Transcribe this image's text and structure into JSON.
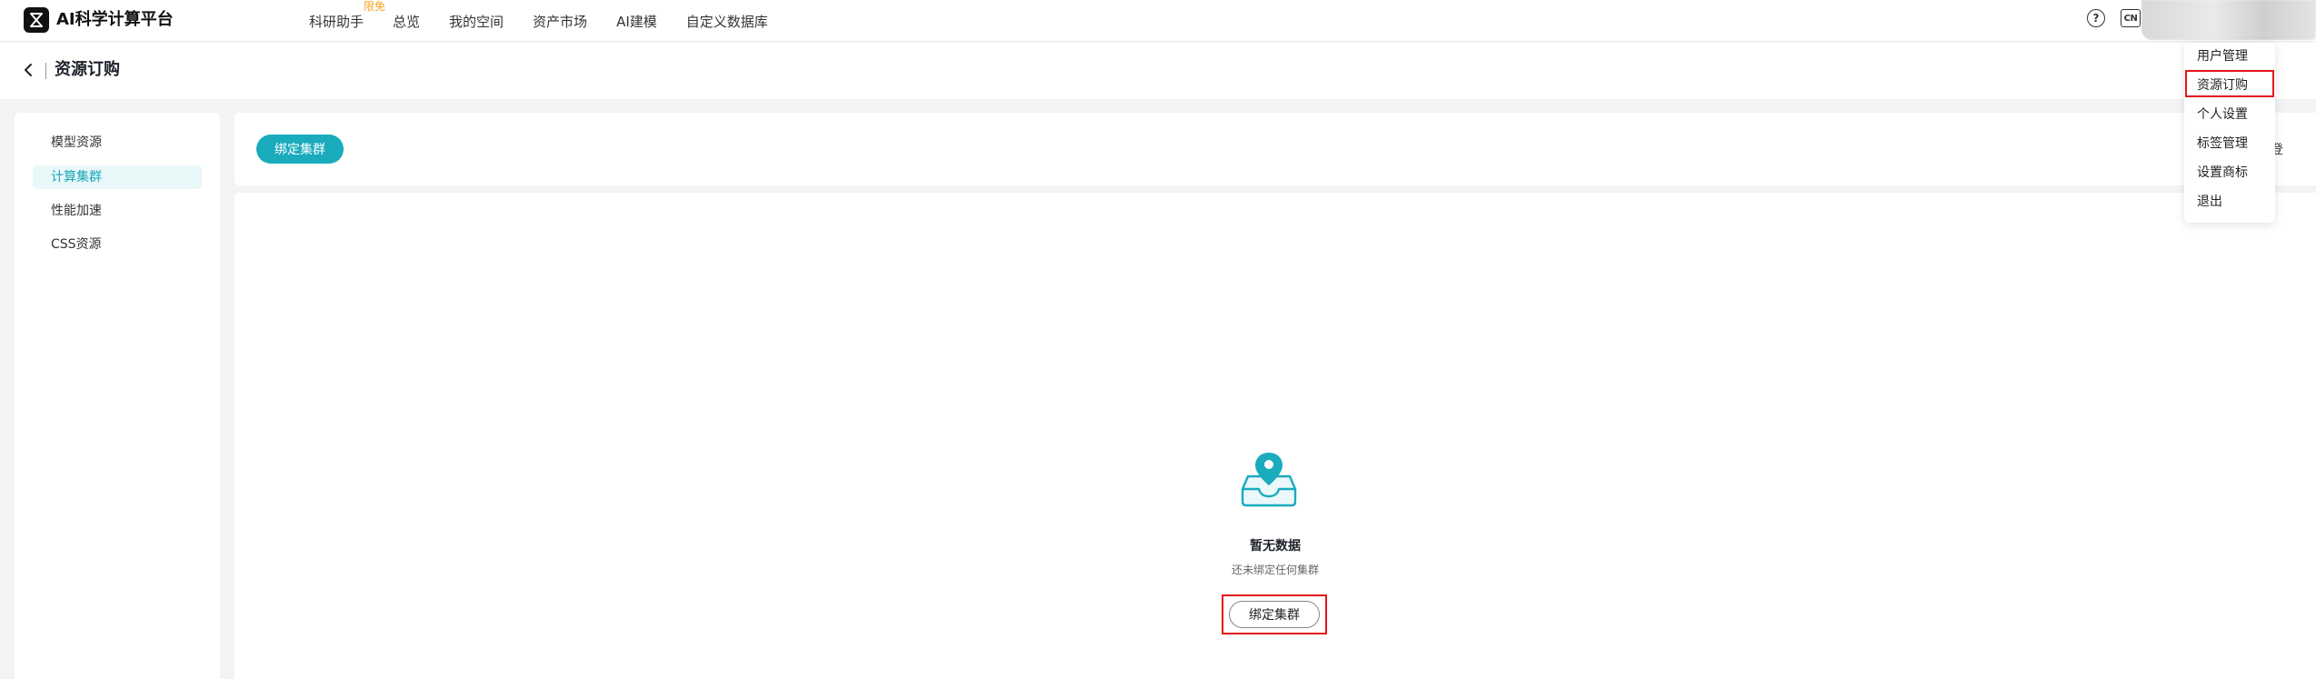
{
  "header": {
    "brand": "AI科学计算平台",
    "nav": [
      {
        "label": "科研助手",
        "badge": "限免"
      },
      {
        "label": "总览"
      },
      {
        "label": "我的空间"
      },
      {
        "label": "资产市场"
      },
      {
        "label": "AI建模"
      },
      {
        "label": "自定义数据库"
      }
    ],
    "lang": "CN",
    "help": "?"
  },
  "user_menu": {
    "items": [
      "用户管理",
      "资源订购",
      "个人设置",
      "标签管理",
      "设置商标",
      "退出"
    ],
    "selected": "资源订购"
  },
  "subheader": {
    "title": "资源订购"
  },
  "sidebar": {
    "items": [
      "模型资源",
      "计算集群",
      "性能加速",
      "CSS资源"
    ],
    "active": "计算集群"
  },
  "toolbar": {
    "bind_label": "绑定集群",
    "cut_text": "登"
  },
  "empty_state": {
    "title": "暂无数据",
    "desc": "还未绑定任何集群",
    "button": "绑定集群"
  },
  "colors": {
    "accent": "#1aabbd",
    "highlight": "#e5141a",
    "badge": "#f7a21b"
  }
}
